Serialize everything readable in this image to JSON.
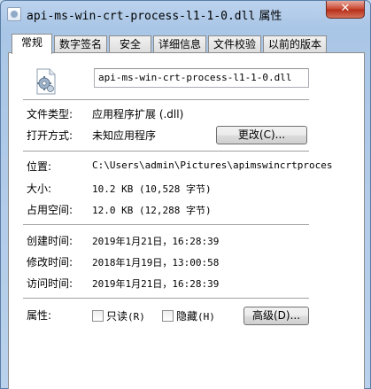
{
  "window": {
    "title_name": "api-ms-win-crt-process-l1-1-0.dll",
    "title_suffix": " 属性",
    "close_label": "✕"
  },
  "tabs": [
    {
      "label": "常规",
      "active": true
    },
    {
      "label": "数字签名"
    },
    {
      "label": "安全"
    },
    {
      "label": "详细信息"
    },
    {
      "label": "文件校验"
    },
    {
      "label": "以前的版本"
    }
  ],
  "file": {
    "icon": "dll-gear-file-icon",
    "name": "api-ms-win-crt-process-l1-1-0.dll"
  },
  "type": {
    "label": "文件类型:",
    "value": "应用程序扩展 (.dll)"
  },
  "opens_with": {
    "label": "打开方式:",
    "value": "未知应用程序",
    "change_button": "更改(C)..."
  },
  "location": {
    "label": "位置:",
    "value": "C:\\Users\\admin\\Pictures\\apimswincrtproces"
  },
  "size": {
    "label": "大小:",
    "value": "10.2 KB (10,528 字节)"
  },
  "size_on_disk": {
    "label": "占用空间:",
    "value": "12.0 KB (12,288 字节)"
  },
  "created": {
    "label": "创建时间:",
    "value": "2019年1月21日，16:28:39"
  },
  "modified": {
    "label": "修改时间:",
    "value": "2018年1月19日，13:00:58"
  },
  "accessed": {
    "label": "访问时间:",
    "value": "2019年1月21日，16:28:39"
  },
  "attributes": {
    "label": "属性:",
    "readonly_label": "只读",
    "readonly_hotkey": "(R)",
    "hidden_label": "隐藏",
    "hidden_hotkey": "(H)",
    "advanced_button": "高级(D)..."
  }
}
